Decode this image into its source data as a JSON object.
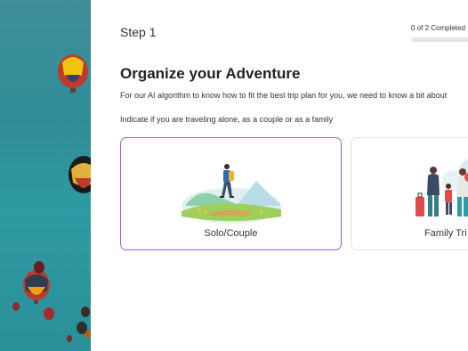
{
  "step": {
    "label": "Step 1"
  },
  "progress": {
    "text": "0 of 2 Completed",
    "completed": 0,
    "total": 2,
    "fraction": 0.0
  },
  "heading": {
    "title": "Organize your Adventure"
  },
  "intro": {
    "text": "For our AI algorithm to know how to fit the best trip plan for you, we need to know a bit about"
  },
  "hint": {
    "text": "Indicate if you are traveling alone, as a couple or as a family"
  },
  "options": [
    {
      "label": "Solo/Couple",
      "selected": true,
      "illustration": "hiker-illustration"
    },
    {
      "label": "Family Tri",
      "selected": false,
      "illustration": "family-illustration"
    }
  ],
  "colors": {
    "accent": "#b35ad0",
    "sky": "#2f8d97"
  }
}
